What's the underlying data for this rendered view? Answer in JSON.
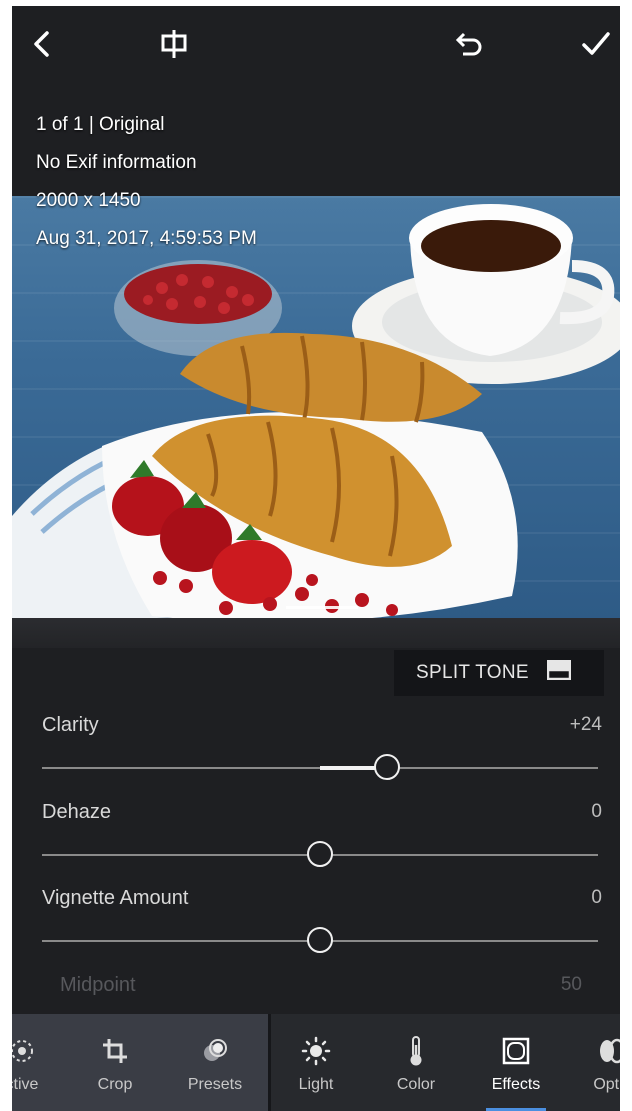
{
  "topbar": {
    "back_icon": "chevron-left-icon",
    "compare_icon": "compare-icon",
    "undo_icon": "undo-icon",
    "done_icon": "checkmark-icon"
  },
  "photo_info": {
    "line1": "1 of 1 | Original",
    "line2": "No Exif information",
    "line3": "2000 x 1450",
    "line4": "Aug 31, 2017, 4:59:53 PM"
  },
  "split_tone": {
    "label": "SPLIT TONE",
    "icon": "split-tone-icon"
  },
  "sliders": [
    {
      "label": "Clarity",
      "value": "+24",
      "level": 0.62
    },
    {
      "label": "Dehaze",
      "value": "0",
      "level": 0.5
    },
    {
      "label": "Vignette Amount",
      "value": "0",
      "level": 0.5
    },
    {
      "label": "Midpoint",
      "value": "50",
      "level": 0.5
    }
  ],
  "tools": [
    {
      "label": "ctive",
      "icon": "selective-icon"
    },
    {
      "label": "Crop",
      "icon": "crop-icon"
    },
    {
      "label": "Presets",
      "icon": "presets-icon"
    },
    {
      "label": "Light",
      "icon": "sun-icon"
    },
    {
      "label": "Color",
      "icon": "thermometer-icon"
    },
    {
      "label": "Effects",
      "icon": "vignette-icon",
      "active": true
    },
    {
      "label": "Optic",
      "icon": "optics-icon"
    }
  ],
  "colors": {
    "background": "#1e1f22",
    "toolbar_left": "#3a3d45",
    "accent": "#4b8fe0"
  }
}
